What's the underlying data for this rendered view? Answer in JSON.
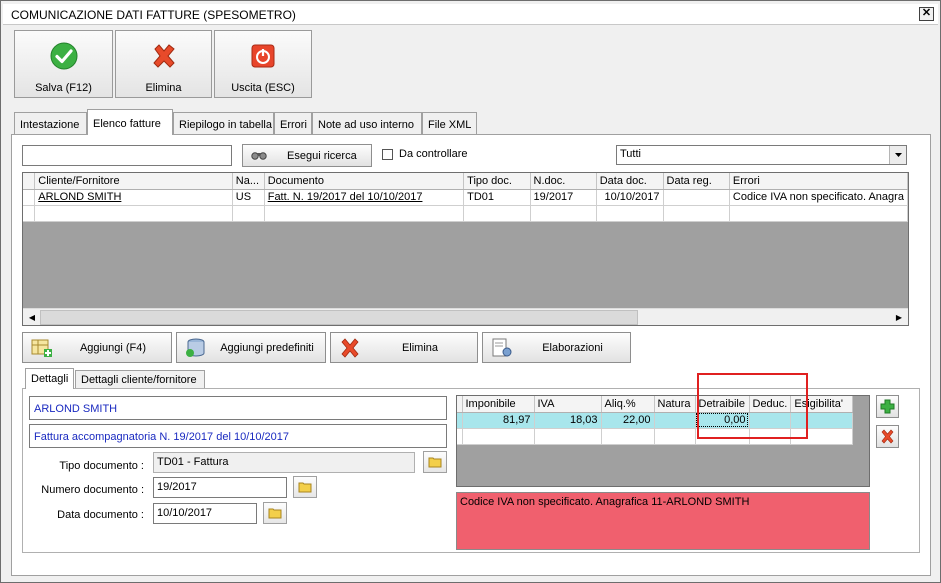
{
  "window": {
    "title": "COMUNICAZIONE DATI FATTURE (SPESOMETRO)",
    "close_symbol": "✕"
  },
  "toolbar": {
    "save_label": "Salva (F12)",
    "delete_label": "Elimina",
    "exit_label": "Uscita (ESC)"
  },
  "tabs": [
    "Intestazione",
    "Elenco fatture",
    "Riepilogo in tabella",
    "Errori",
    "Note ad uso interno",
    "File XML"
  ],
  "active_tab": "Elenco fatture",
  "search": {
    "value": "",
    "button_label": "Esegui ricerca",
    "check_label": "Da controllare",
    "checked": false,
    "filter_value": "Tutti"
  },
  "invoices": {
    "columns": [
      "Cliente/Fornitore",
      "Na...",
      "Documento",
      "Tipo doc.",
      "N.doc.",
      "Data doc.",
      "Data reg.",
      "Errori"
    ],
    "rows": [
      {
        "cliente": "ARLOND SMITH",
        "na": "US",
        "documento": "Fatt. N. 19/2017 del 10/10/2017",
        "tipo": "TD01",
        "ndoc": "19/2017",
        "data_doc": "10/10/2017",
        "data_reg": "",
        "errori": "Codice IVA non specificato. Anagra"
      }
    ]
  },
  "actions": {
    "add_label": "Aggiungi (F4)",
    "add_default_label": "Aggiungi predefiniti",
    "delete_label": "Elimina",
    "process_label": "Elaborazioni"
  },
  "detail_tabs": [
    "Dettagli",
    "Dettagli cliente/fornitore"
  ],
  "details": {
    "party": "ARLOND SMITH",
    "description": "Fattura accompagnatoria N. 19/2017 del 10/10/2017",
    "doc_type_label": "Tipo documento :",
    "doc_type_value": "TD01 - Fattura",
    "doc_number_label": "Numero documento :",
    "doc_number_value": "19/2017",
    "doc_date_label": "Data documento :",
    "doc_date_value": "10/10/2017"
  },
  "vat": {
    "columns": [
      "Imponibile",
      "IVA",
      "Aliq.%",
      "Natura",
      "Detraibile",
      "Deduc.",
      "Esigibilita'"
    ],
    "rows": [
      {
        "imponibile": "81,97",
        "iva": "18,03",
        "aliq": "22,00",
        "natura": "",
        "detraibile": "0,00",
        "deduc": "",
        "esigibilita": ""
      }
    ]
  },
  "errors_text": "Codice IVA non specificato. Anagrafica 11-ARLOND SMITH",
  "colors": {
    "selected_row": "#a8e6ec",
    "error_bg": "#f0606e",
    "highlight_box": "#e02020",
    "link_blue": "#1a2ac0"
  }
}
